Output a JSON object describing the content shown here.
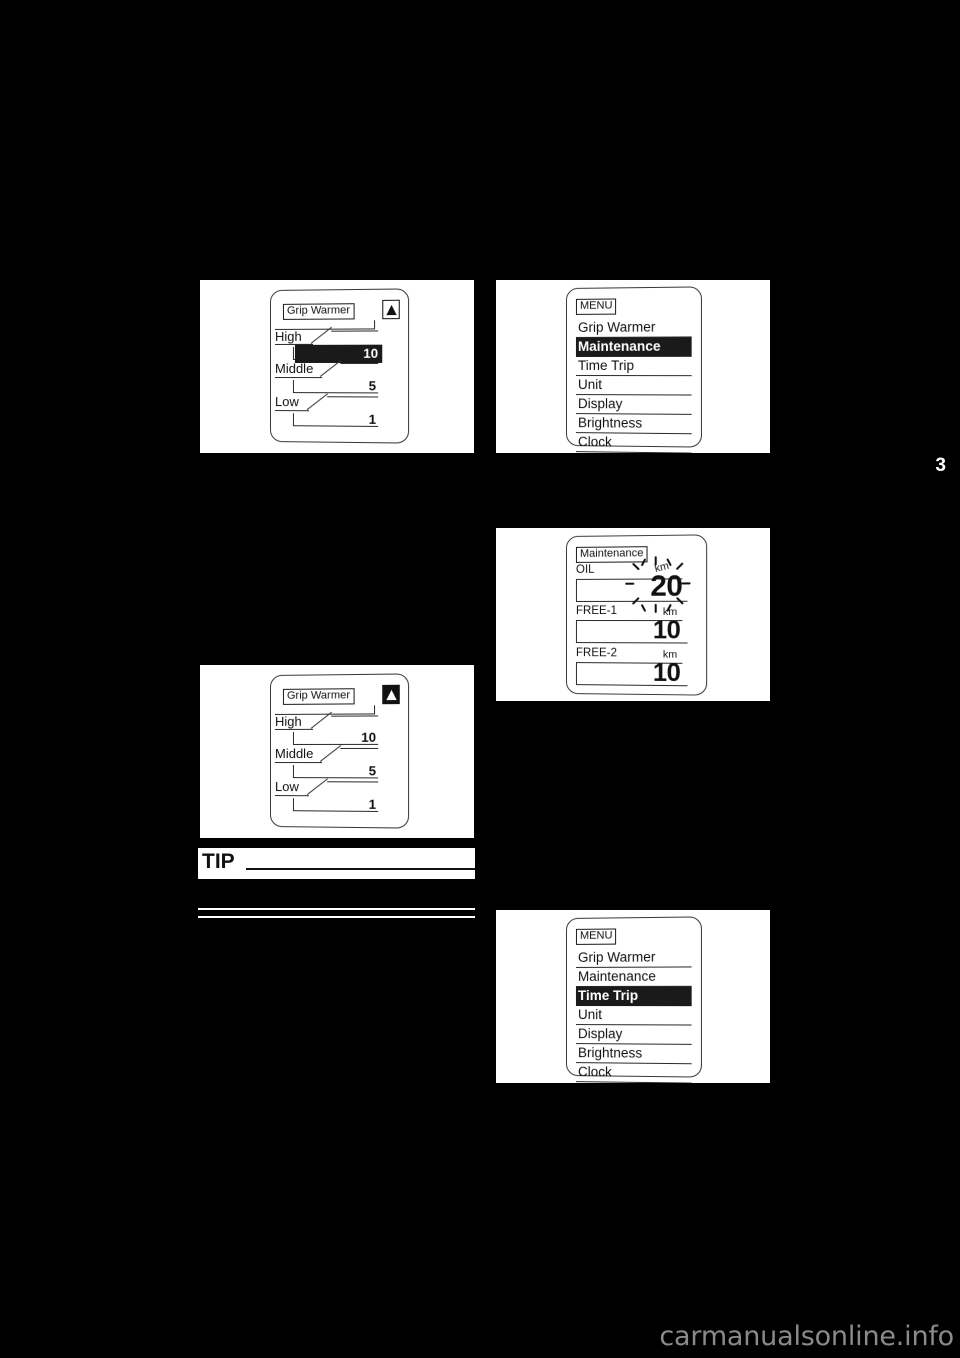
{
  "page": {
    "number": "3",
    "watermark": "carmanualsonline.info"
  },
  "figures": {
    "grip_warmer_adjust": {
      "tag": "Grip Warmer",
      "indicator_icon": "up-triangle-icon",
      "rows": [
        {
          "label": "High",
          "value": "10",
          "highlighted": true
        },
        {
          "label": "Middle",
          "value": "5",
          "highlighted": false
        },
        {
          "label": "Low",
          "value": "1",
          "highlighted": false
        }
      ]
    },
    "grip_warmer_confirm": {
      "tag": "Grip Warmer",
      "indicator_icon": "up-triangle-icon",
      "rows": [
        {
          "label": "High",
          "value": "10",
          "highlighted": false
        },
        {
          "label": "Middle",
          "value": "5",
          "highlighted": false
        },
        {
          "label": "Low",
          "value": "1",
          "highlighted": false
        }
      ]
    },
    "menu_maintenance": {
      "tag": "MENU",
      "items": [
        {
          "label": "Grip Warmer",
          "selected": false
        },
        {
          "label": "Maintenance",
          "selected": true
        },
        {
          "label": "Time Trip",
          "selected": false
        },
        {
          "label": "Unit",
          "selected": false
        },
        {
          "label": "Display",
          "selected": false
        },
        {
          "label": "Brightness",
          "selected": false
        },
        {
          "label": "Clock",
          "selected": false
        }
      ]
    },
    "menu_time_trip": {
      "tag": "MENU",
      "items": [
        {
          "label": "Grip Warmer",
          "selected": false
        },
        {
          "label": "Maintenance",
          "selected": false
        },
        {
          "label": "Time Trip",
          "selected": true
        },
        {
          "label": "Unit",
          "selected": false
        },
        {
          "label": "Display",
          "selected": false
        },
        {
          "label": "Brightness",
          "selected": false
        },
        {
          "label": "Clock",
          "selected": false
        }
      ]
    },
    "maintenance": {
      "tag": "Maintenance",
      "rows": [
        {
          "label": "OIL",
          "unit": "km",
          "value": "20",
          "flashing": true
        },
        {
          "label": "FREE-1",
          "unit": "km",
          "value": "10",
          "flashing": false
        },
        {
          "label": "FREE-2",
          "unit": "km",
          "value": "10",
          "flashing": false
        }
      ]
    }
  },
  "tip": {
    "heading": "TIP",
    "body": ""
  }
}
